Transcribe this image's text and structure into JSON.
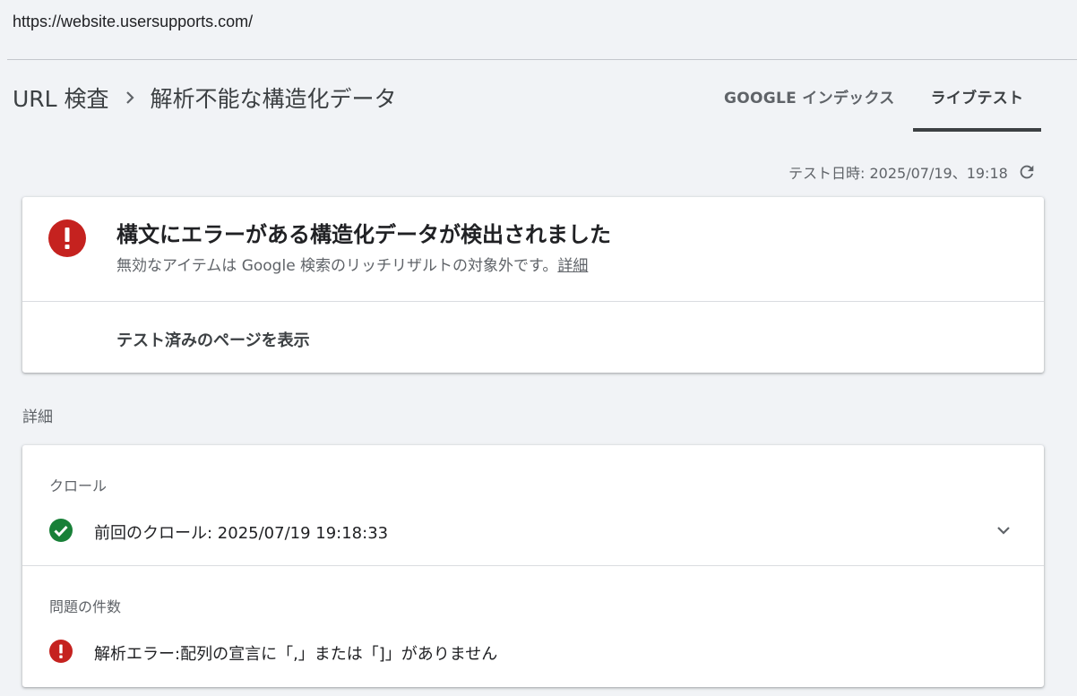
{
  "url": "https://website.usersupports.com/",
  "breadcrumb": {
    "root": "URL 検査",
    "current": "解析不能な構造化データ"
  },
  "tabs": [
    {
      "label": "GOOGLE インデックス",
      "active": false
    },
    {
      "label": "ライブテスト",
      "active": true
    }
  ],
  "test_time": "テスト日時: 2025/07/19、19:18",
  "status": {
    "title": "構文にエラーがある構造化データが検出されました",
    "subtitle": "無効なアイテムは Google 検索のリッチリザルトの対象外です。",
    "link": "詳細",
    "view_page": "テスト済みのページを表示"
  },
  "details_label": "詳細",
  "crawl": {
    "heading": "クロール",
    "last_crawl": "前回のクロール: 2025/07/19 19:18:33"
  },
  "issues": {
    "heading": "問題の件数",
    "item": "解析エラー:配列の宣言に「,」または「]」がありません"
  },
  "colors": {
    "error": "#c5221f",
    "success": "#188038",
    "tab_indicator": "#3c4043"
  }
}
